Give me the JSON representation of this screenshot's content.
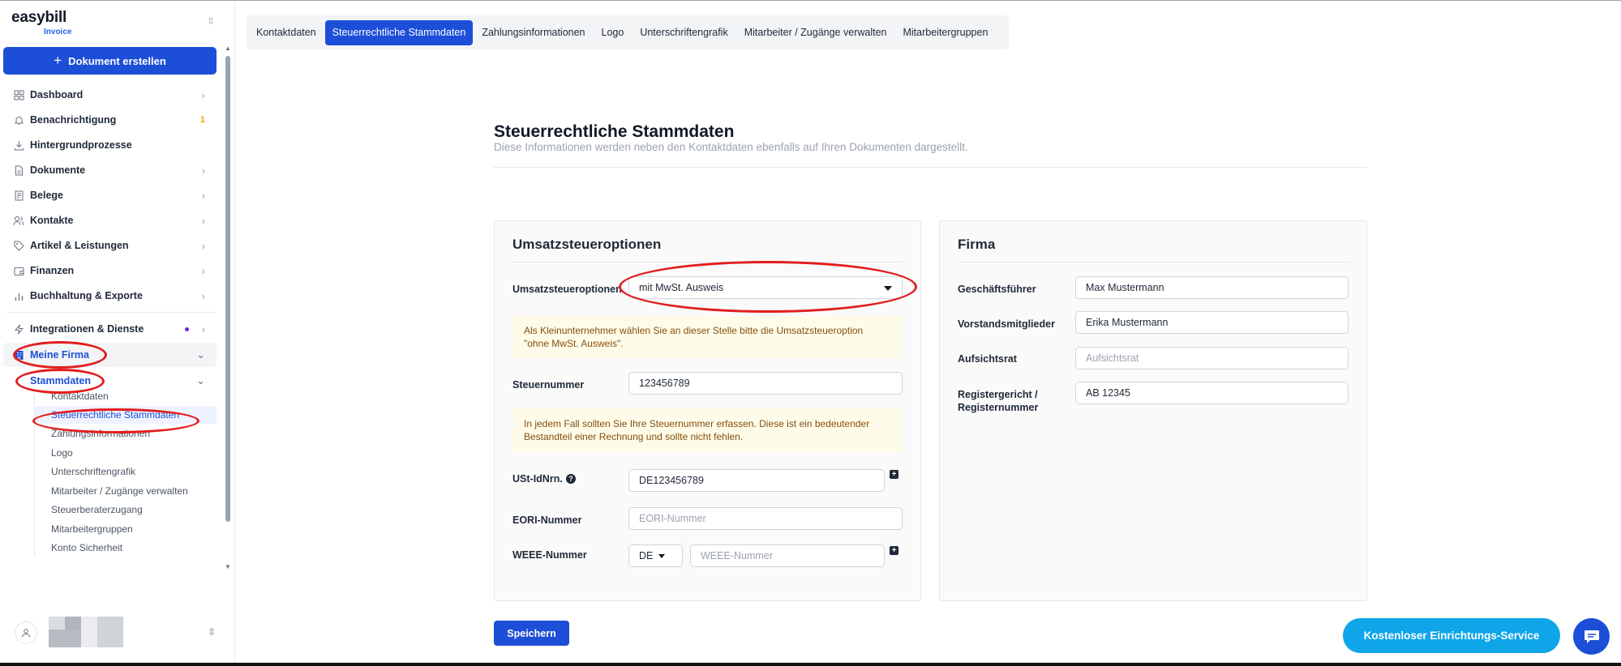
{
  "brand": {
    "name": "easybill",
    "product": "Invoice"
  },
  "sidebar": {
    "create_button": "Dokument erstellen",
    "items": [
      {
        "label": "Dashboard",
        "icon": "grid-icon"
      },
      {
        "label": "Benachrichtigung",
        "icon": "bell-icon",
        "badge": "1"
      },
      {
        "label": "Hintergrundprozesse",
        "icon": "download-icon"
      },
      {
        "label": "Dokumente",
        "icon": "document-icon"
      },
      {
        "label": "Belege",
        "icon": "receipt-icon"
      },
      {
        "label": "Kontakte",
        "icon": "users-icon"
      },
      {
        "label": "Artikel & Leistungen",
        "icon": "tag-icon"
      },
      {
        "label": "Finanzen",
        "icon": "wallet-icon"
      },
      {
        "label": "Buchhaltung & Exporte",
        "icon": "bar-chart-icon"
      },
      {
        "label": "Integrationen & Dienste",
        "icon": "lightning-icon"
      },
      {
        "label": "Meine Firma",
        "icon": "building-icon"
      }
    ],
    "stammdaten_label": "Stammdaten",
    "sub_items": [
      "Kontaktdaten",
      "Steuerrechtliche Stammdaten",
      "Zahlungsinformationen",
      "Logo",
      "Unterschriftengrafik",
      "Mitarbeiter / Zugänge verwalten",
      "Steuerberaterzugang",
      "Mitarbeitergruppen",
      "Konto Sicherheit"
    ]
  },
  "tabs": [
    "Kontaktdaten",
    "Steuerrechtliche Stammdaten",
    "Zahlungsinformationen",
    "Logo",
    "Unterschriftengrafik",
    "Mitarbeiter / Zugänge verwalten",
    "Mitarbeitergruppen"
  ],
  "page": {
    "title": "Steuerrechtliche Stammdaten",
    "description": "Diese Informationen werden neben den Kontaktdaten ebenfalls auf Ihren Dokumenten dargestellt."
  },
  "tax_card": {
    "title": "Umsatzsteueroptionen",
    "vat_option_label": "Umsatzsteueroptionen",
    "vat_option_value": "mit MwSt. Ausweis",
    "note_small_business": "Als Kleinunternehmer wählen Sie an dieser Stelle bitte die Umsatzsteueroption \"ohne MwSt. Ausweis\".",
    "tax_number_label": "Steuernummer",
    "tax_number_value": "123456789",
    "note_tax_number": "In jedem Fall sollten Sie Ihre Steuernummer erfassen. Diese ist ein bedeutender Bestandteil einer Rechnung und sollte nicht fehlen.",
    "vat_id_label": "USt-IdNrn.",
    "vat_id_value": "DE123456789",
    "eori_label": "EORI-Nummer",
    "eori_placeholder": "EORI-Nummer",
    "weee_label": "WEEE-Nummer",
    "weee_country": "DE",
    "weee_placeholder": "WEEE-Nummer"
  },
  "company_card": {
    "title": "Firma",
    "managing_director_label": "Geschäftsführer",
    "managing_director_value": "Max Mustermann",
    "board_label": "Vorstandsmitglieder",
    "board_value": "Erika Mustermann",
    "supervisory_label": "Aufsichtsrat",
    "supervisory_placeholder": "Aufsichtsrat",
    "register_label": "Registergericht / Registernummer",
    "register_value": "AB 12345"
  },
  "save_button": "Speichern",
  "service_button": "Kostenloser Einrichtungs-Service",
  "colors": {
    "primary": "#1d4ed8",
    "service": "#0ea5e9",
    "annotation": "#e11d1d",
    "note_bg": "#fefce8"
  }
}
